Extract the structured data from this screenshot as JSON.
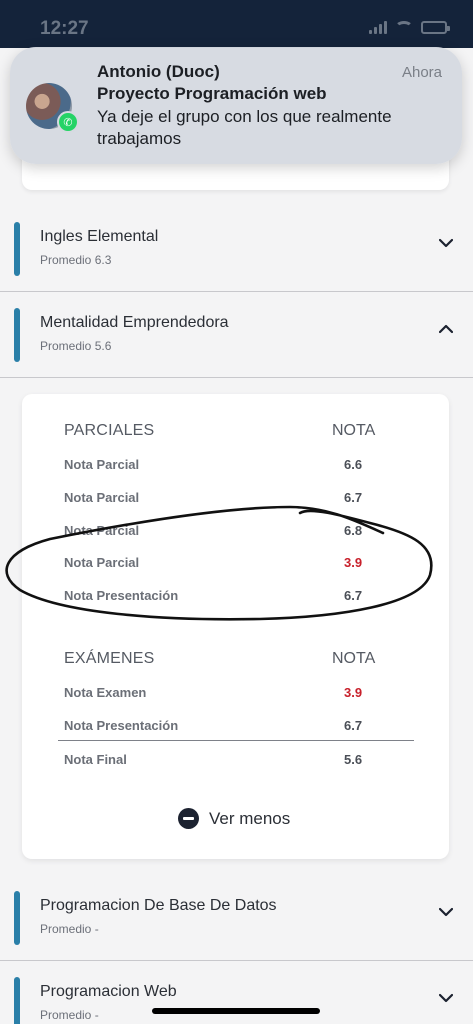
{
  "status_bar": {
    "time": "12:27"
  },
  "notification": {
    "sender": "Antonio (Duoc)",
    "time": "Ahora",
    "group": "Proyecto Programación web",
    "message": "Ya deje el grupo con los que realmente trabajamos",
    "app_icon": "whatsapp-icon"
  },
  "subjects": [
    {
      "name": "Ingles Elemental",
      "average": "Promedio 6.3",
      "expanded": false
    },
    {
      "name": "Mentalidad Emprendedora",
      "average": "Promedio 5.6",
      "expanded": true
    },
    {
      "name": "Programacion De Base De Datos",
      "average": "Promedio -",
      "expanded": false
    },
    {
      "name": "Programacion Web",
      "average": "Promedio -",
      "expanded": false
    }
  ],
  "grades": {
    "partials_header": "PARCIALES",
    "partials_grade_header": "NOTA",
    "partials": [
      {
        "label": "Nota Parcial",
        "value": "6.6",
        "low": false
      },
      {
        "label": "Nota Parcial",
        "value": "6.7",
        "low": false
      },
      {
        "label": "Nota Parcial",
        "value": "6.8",
        "low": false
      },
      {
        "label": "Nota Parcial",
        "value": "3.9",
        "low": true
      },
      {
        "label": "Nota Presentación",
        "value": "6.7",
        "low": false
      }
    ],
    "exams_header": "EXÁMENES",
    "exams_grade_header": "NOTA",
    "exams": [
      {
        "label": "Nota Examen",
        "value": "3.9",
        "low": true
      },
      {
        "label": "Nota Presentación",
        "value": "6.7",
        "low": false
      }
    ],
    "final": {
      "label": "Nota Final",
      "value": "5.6"
    },
    "toggle_label": "Ver menos"
  },
  "colors": {
    "accent": "#2a7fa8",
    "low_grade": "#c8202b",
    "header_bg": "#14233a"
  }
}
